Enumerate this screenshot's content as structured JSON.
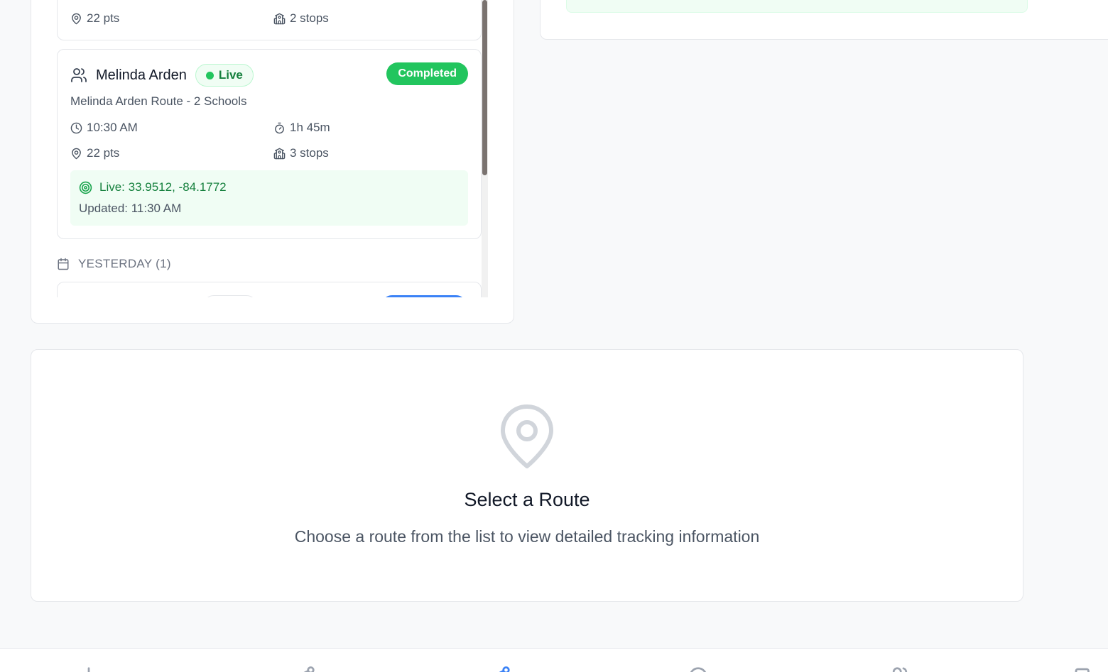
{
  "routes_list": {
    "previous_card": {
      "points": "22 pts",
      "stops": "2 stops"
    },
    "active_card": {
      "driver_name": "Melinda Arden",
      "live_label": "Live",
      "status": "Completed",
      "route_name": "Melinda Arden Route - 2 Schools",
      "start_time": "10:30 AM",
      "duration": "1h 45m",
      "points": "22 pts",
      "stops": "3 stops",
      "live_coords": "Live: 33.9512, -84.1772",
      "updated": "Updated: 11:30 AM"
    },
    "section_yesterday": "YESTERDAY (1)"
  },
  "empty_state": {
    "icon": "map-pin-icon",
    "title": "Select a Route",
    "subtitle": "Choose a route from the list to view detailed tracking information"
  },
  "colors": {
    "live_green": "#22c55e",
    "live_text": "#15803d",
    "completed_badge": "#22c55e",
    "in_progress_badge": "#3b82f6",
    "active_nav": "#3b82f6"
  },
  "bottom_nav": {
    "items": [
      "dashboard-icon",
      "routes-icon",
      "tracking-icon",
      "search-icon",
      "drivers-icon",
      "reports-icon"
    ],
    "active_index": 2
  }
}
